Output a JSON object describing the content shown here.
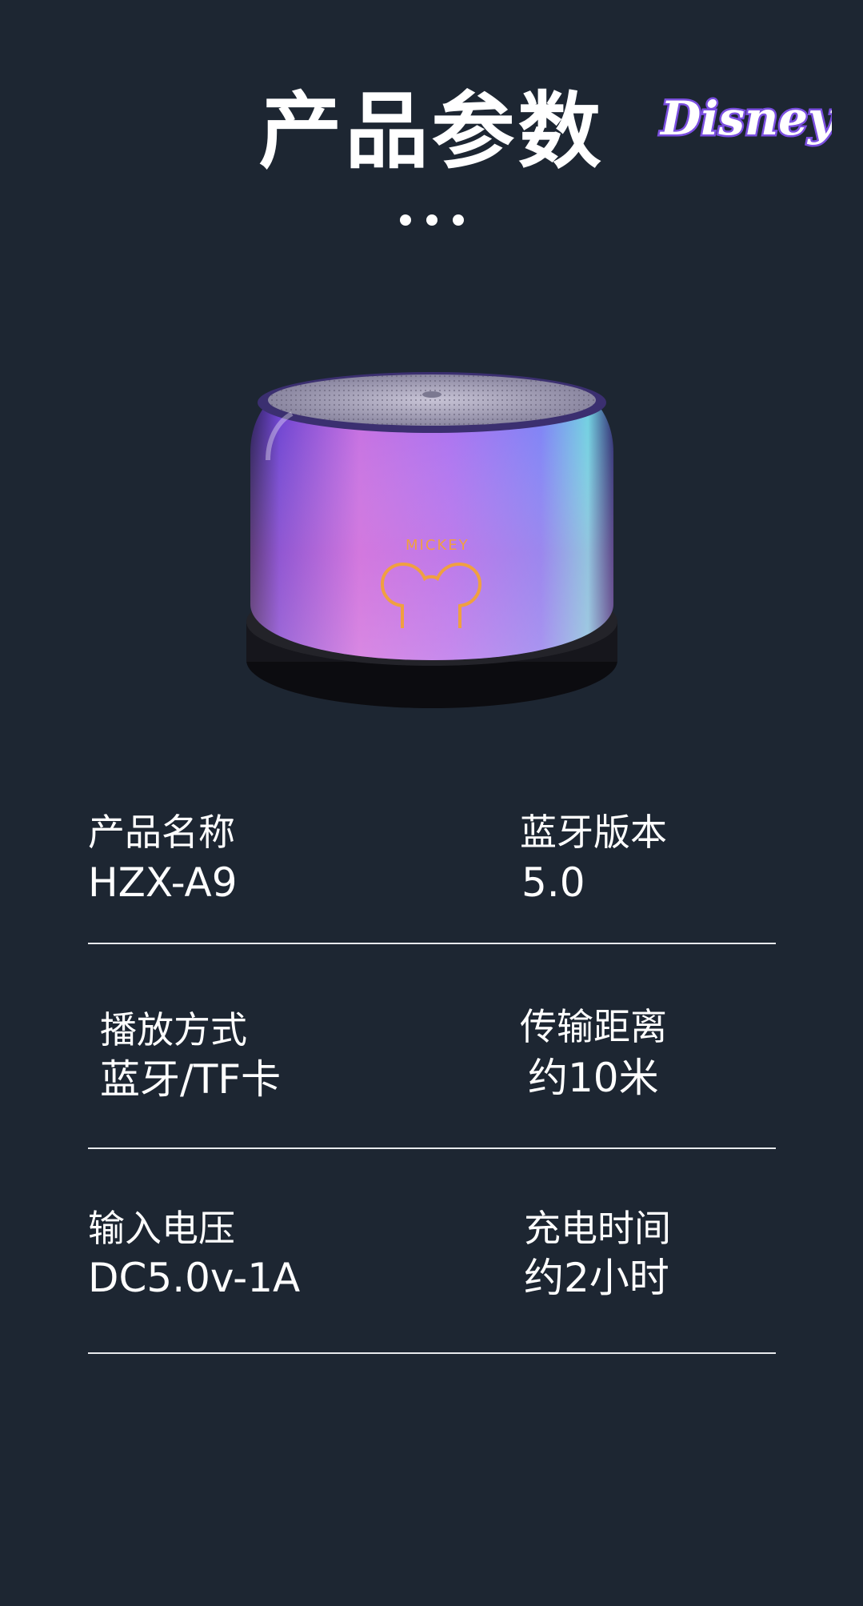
{
  "header": {
    "title": "产品参数",
    "brand_logo_text": "Disney"
  },
  "product_image": {
    "brand_text": "MICKEY",
    "icon": "mickey-ears-icon"
  },
  "specs": [
    {
      "label": "产品名称",
      "value": "HZX-A9"
    },
    {
      "label": "蓝牙版本",
      "value": "5.0"
    },
    {
      "label": "播放方式",
      "value": "蓝牙/TF卡"
    },
    {
      "label": "传输距离",
      "value": "约10米"
    },
    {
      "label": "输入电压",
      "value": "DC5.0v-1A"
    },
    {
      "label": "充电时间",
      "value": "约2小时"
    }
  ],
  "colors": {
    "background": "#1d2632",
    "text": "#ffffff",
    "divider": "#e8eaed",
    "logo_purple": "#7b4fe0",
    "speaker_accent": "#f0a040"
  }
}
